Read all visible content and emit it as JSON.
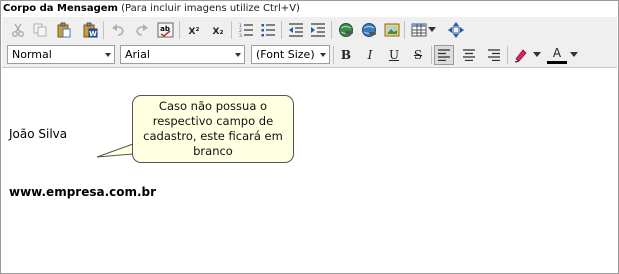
{
  "header": {
    "title": "Corpo da Mensagem",
    "hint": "(Para incluir imagens utilize Ctrl+V)"
  },
  "toolbar": {
    "row1_icons": [
      "cut-icon",
      "copy-icon",
      "paste-icon",
      "paste-word-icon",
      "undo-icon",
      "redo-icon",
      "spellcheck-icon",
      "superscript-icon",
      "subscript-icon",
      "numbered-list-icon",
      "bullet-list-icon",
      "outdent-icon",
      "indent-icon",
      "link-icon",
      "unlink-icon",
      "image-icon",
      "table-icon",
      "table-dropdown-icon",
      "move-icon"
    ],
    "superscript_label": "X²",
    "subscript_label": "X₂",
    "paragraph_format": "Normal",
    "font_name": "Arial",
    "font_size": "(Font Size)",
    "bold_label": "B",
    "italic_label": "I",
    "underline_label": "U",
    "strike_label": "S",
    "font_color_label": "A",
    "colors": {
      "highlight": "#e0245e",
      "font_color": "#000000",
      "active_bg": "#dcdcdc"
    }
  },
  "content": {
    "name": "João Silva",
    "website": "www.empresa.com.br"
  },
  "callout": {
    "text": "Caso não possua o respectivo campo de cadastro, este ficará em branco"
  }
}
